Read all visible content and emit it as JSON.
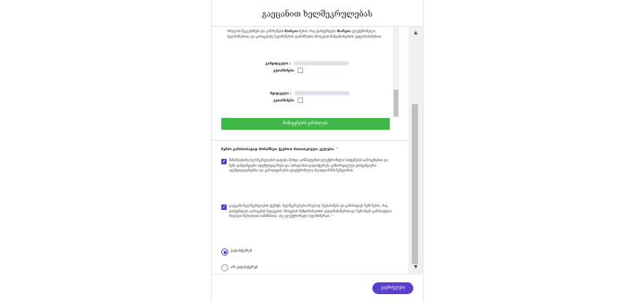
{
  "modal": {
    "title": "გაეცანით ხელშეკრულებას",
    "document": {
      "text_parts": [
        "ხრელით შეეგებინება და გამოსეწყის ",
        "მხარეთა",
        " ნების, რაც დასტურდება ",
        "მხარეთა",
        " ელექტრონული ხელმოწერითა და გარიგებაზე ხელმოწერის დამოწმების პროცესის მიმდინარეობის ვიდეოჩანაწერით."
      ],
      "sign1_label": "გამყიდველი :",
      "sign1_check": "ვეთანხმები",
      "sign2_label": "მყიდველი :",
      "sign2_check": "ვეთანხმები"
    },
    "download_button": "მონაცემების განახლება",
    "question": "ჩემის გამოსახატად მონიშნეთ ქვემოთ მითითებული ველები:",
    "question_required": "*",
    "checkbox1_text": "წინამდებარე ხელშეკრულების დადება მოხდა კომპიუტერის ელექტრონული სისტემების გამოყენებით და ჩემი დისტანციური იდენტიფიცირება და პირადობის დადასტურება განხორციელდა დისტანციური იდენტიფიცირებისა და ვერიფიცირების ელექტრონული პლატფორმის მეშვეობით.",
    "checkbox2_text": "გავეცანი ხელშეკრულების ტექსტს, ხელშეკრულება სრულად შეესაბამება და გამოხატავს ჩემს ნებას, რაც დასტურდება გარიგების შედეგების პროცესის მიმდინარეობის ვიდეოჩანაწერით და ჩემი მიერ გამოსატული რიცხვით წერილით თანხმობით, ასე ელექტრონული ხელმოწერით.",
    "checkbox2_required": "*",
    "radio_agree": "ვადასტურებ",
    "radio_disagree": "არ ვადასტურებ",
    "submit_button": "გაგრძელება"
  },
  "colors": {
    "accent": "#5b3fd1",
    "green": "#41b649",
    "required": "#d33333"
  }
}
